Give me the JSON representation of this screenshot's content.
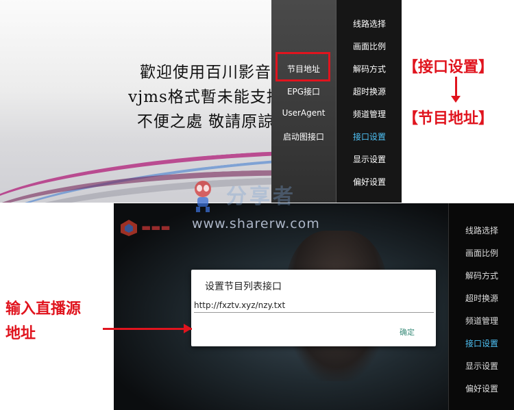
{
  "top": {
    "welcome_lines": [
      "歡迎使用百川影音",
      "vjms格式暫未能支持",
      "不便之處 敬請原諒"
    ],
    "submenu": [
      "节目地址",
      "EPG接口",
      "UserAgent",
      "启动图接口"
    ],
    "menu": [
      "线路选择",
      "画面比例",
      "解码方式",
      "超时换源",
      "频道管理",
      "接口设置",
      "显示设置",
      "偏好设置"
    ],
    "active_menu_index": 5
  },
  "annotations": {
    "from_label": "【接口设置】",
    "to_label": "【节目地址】",
    "input_note_line1": "输入直播源",
    "input_note_line2": "地址"
  },
  "watermark": {
    "text_cn": "分享者",
    "url": "www.sharerw.com"
  },
  "bottom": {
    "dialog": {
      "title": "设置节目列表接口",
      "input_value": "http://fxztv.xyz/nzy.txt",
      "ok_label": "确定"
    },
    "menu": [
      "线路选择",
      "画面比例",
      "解码方式",
      "超时换源",
      "频道管理",
      "接口设置",
      "显示设置",
      "偏好设置"
    ],
    "active_menu_index": 5
  },
  "colors": {
    "annotation_red": "#e0141e",
    "active_menu": "#4fc3f7",
    "ok_button": "#3a8c7a"
  }
}
